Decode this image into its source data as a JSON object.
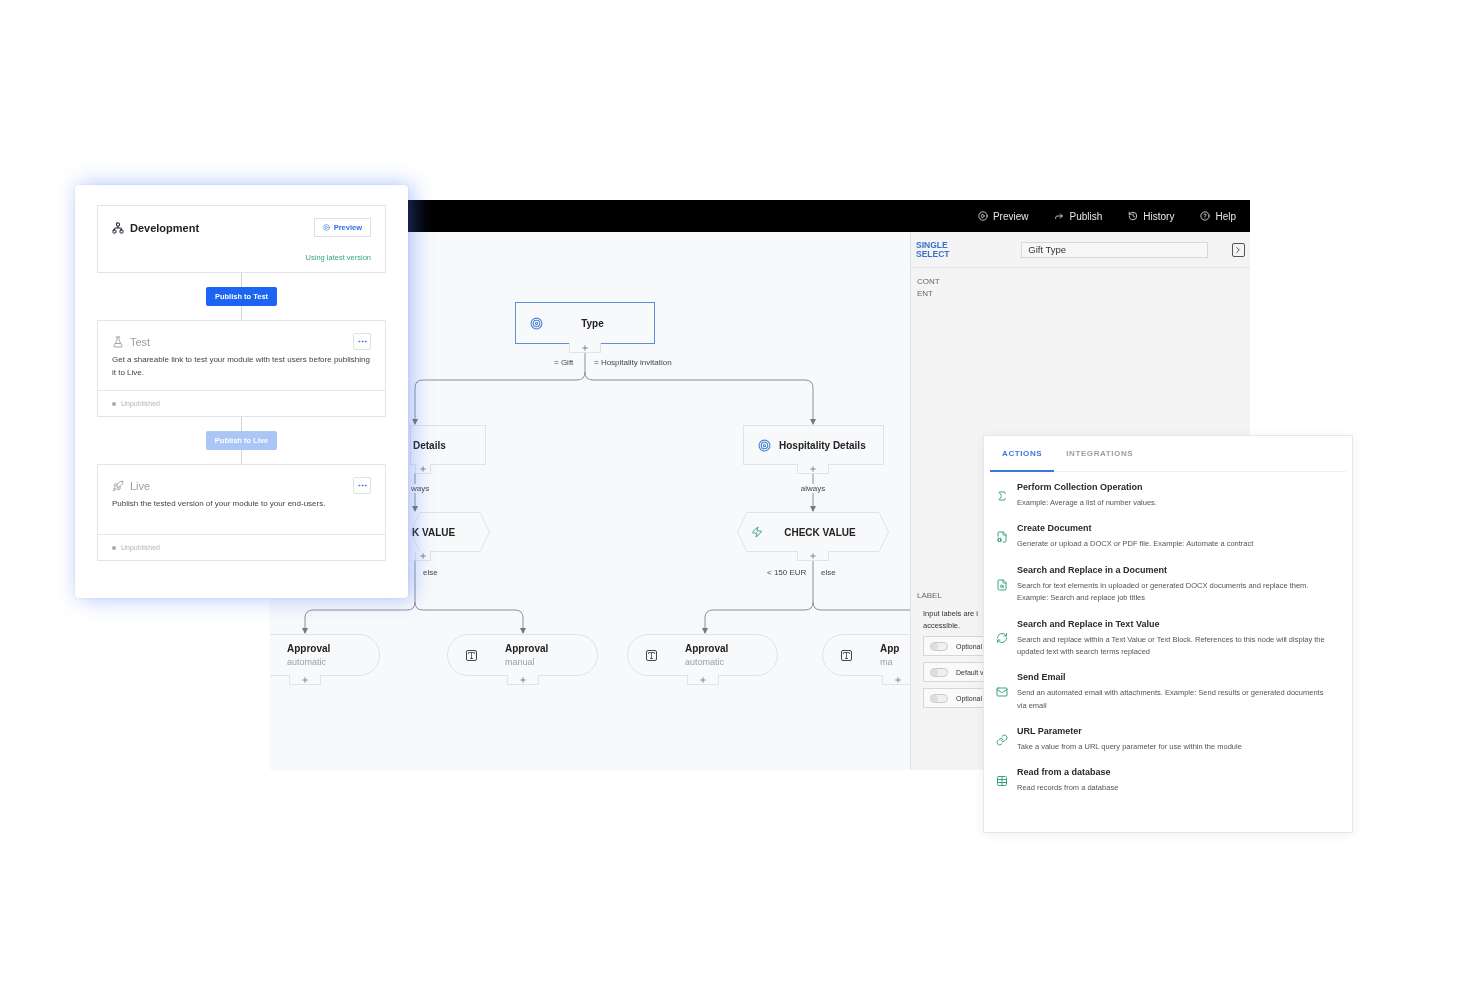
{
  "release_panel": {
    "development": {
      "title": "Development",
      "preview_button": "Preview",
      "version_note": "Using latest version"
    },
    "publish_buttons": [
      {
        "label": "Publish to Test",
        "disabled": false
      },
      {
        "label": "Publish to Live",
        "disabled": true
      }
    ],
    "stages": [
      {
        "kind": "test",
        "title": "Test",
        "description": "Get a shareable link to test your module with test users before publishing it to Live.",
        "status": "Unpublished"
      },
      {
        "kind": "live",
        "title": "Live",
        "description": "Publish the tested version of your module to your end-users.",
        "status": "Unpublished"
      }
    ]
  },
  "toolbar": [
    {
      "label": "Preview"
    },
    {
      "label": "Publish"
    },
    {
      "label": "History"
    },
    {
      "label": "Help"
    }
  ],
  "flow": {
    "nodes": [
      {
        "kind": "question",
        "title": "Type",
        "icon": true,
        "selected": true
      },
      {
        "kind": "question",
        "title": "Details",
        "icon": false,
        "selected": false
      },
      {
        "kind": "question",
        "title": "Hospitality Details",
        "icon": true,
        "selected": false
      },
      {
        "kind": "check",
        "title": "K VALUE",
        "icon": false,
        "selected": false
      },
      {
        "kind": "check",
        "title": "CHECK VALUE",
        "icon": true,
        "selected": false
      },
      {
        "kind": "approval",
        "title": "Approval",
        "subtitle": "automatic",
        "icon": false,
        "selected": false
      },
      {
        "kind": "approval",
        "title": "Approval",
        "subtitle": "manual",
        "icon": true,
        "selected": false
      },
      {
        "kind": "approval",
        "title": "Approval",
        "subtitle": "automatic",
        "icon": true,
        "selected": false
      },
      {
        "kind": "approval",
        "title": "App",
        "subtitle": "ma",
        "icon": true,
        "selected": false
      }
    ],
    "edge_labels": [
      "= Gift",
      "= Hospitality invitation",
      "ways",
      "else",
      "always",
      "< 150 EUR",
      "else"
    ]
  },
  "properties": {
    "type_label": "SINGLE SELECT",
    "name_field": {
      "value": "Gift Type"
    },
    "section_label": "CONTENT",
    "label_section": "LABEL",
    "hint": "Input labels are i accessible.",
    "toggles": [
      {
        "label": "Optional",
        "on": false
      },
      {
        "label": "Default v",
        "on": false
      },
      {
        "label": "Optional",
        "on": false
      }
    ]
  },
  "actions_popup": {
    "tabs": [
      {
        "label": "ACTIONS",
        "selected": true
      },
      {
        "label": "INTEGRATIONS",
        "selected": false
      }
    ],
    "items": [
      {
        "title": "Perform Collection Operation",
        "description": "Example: Average a list of number values."
      },
      {
        "title": "Create Document",
        "description": "Generate or upload a DOCX or PDF file. Example: Automate a contract"
      },
      {
        "title": "Search and Replace in a Document",
        "description": "Search for text elements in uploaded or generated DOCX documents and replace them. Example: Search and replace job titles"
      },
      {
        "title": "Search and Replace in Text Value",
        "description": "Search and replace within a Text Value or Text Block. References to this node will display the updated text with search terms replaced"
      },
      {
        "title": "Send Email",
        "description": "Send an automated email with attachments. Example: Send results or generated documents via email"
      },
      {
        "title": "URL Parameter",
        "description": "Take a value from a URL query parameter for use within the module"
      },
      {
        "title": "Read from a database",
        "description": "Read records from a database"
      }
    ]
  }
}
